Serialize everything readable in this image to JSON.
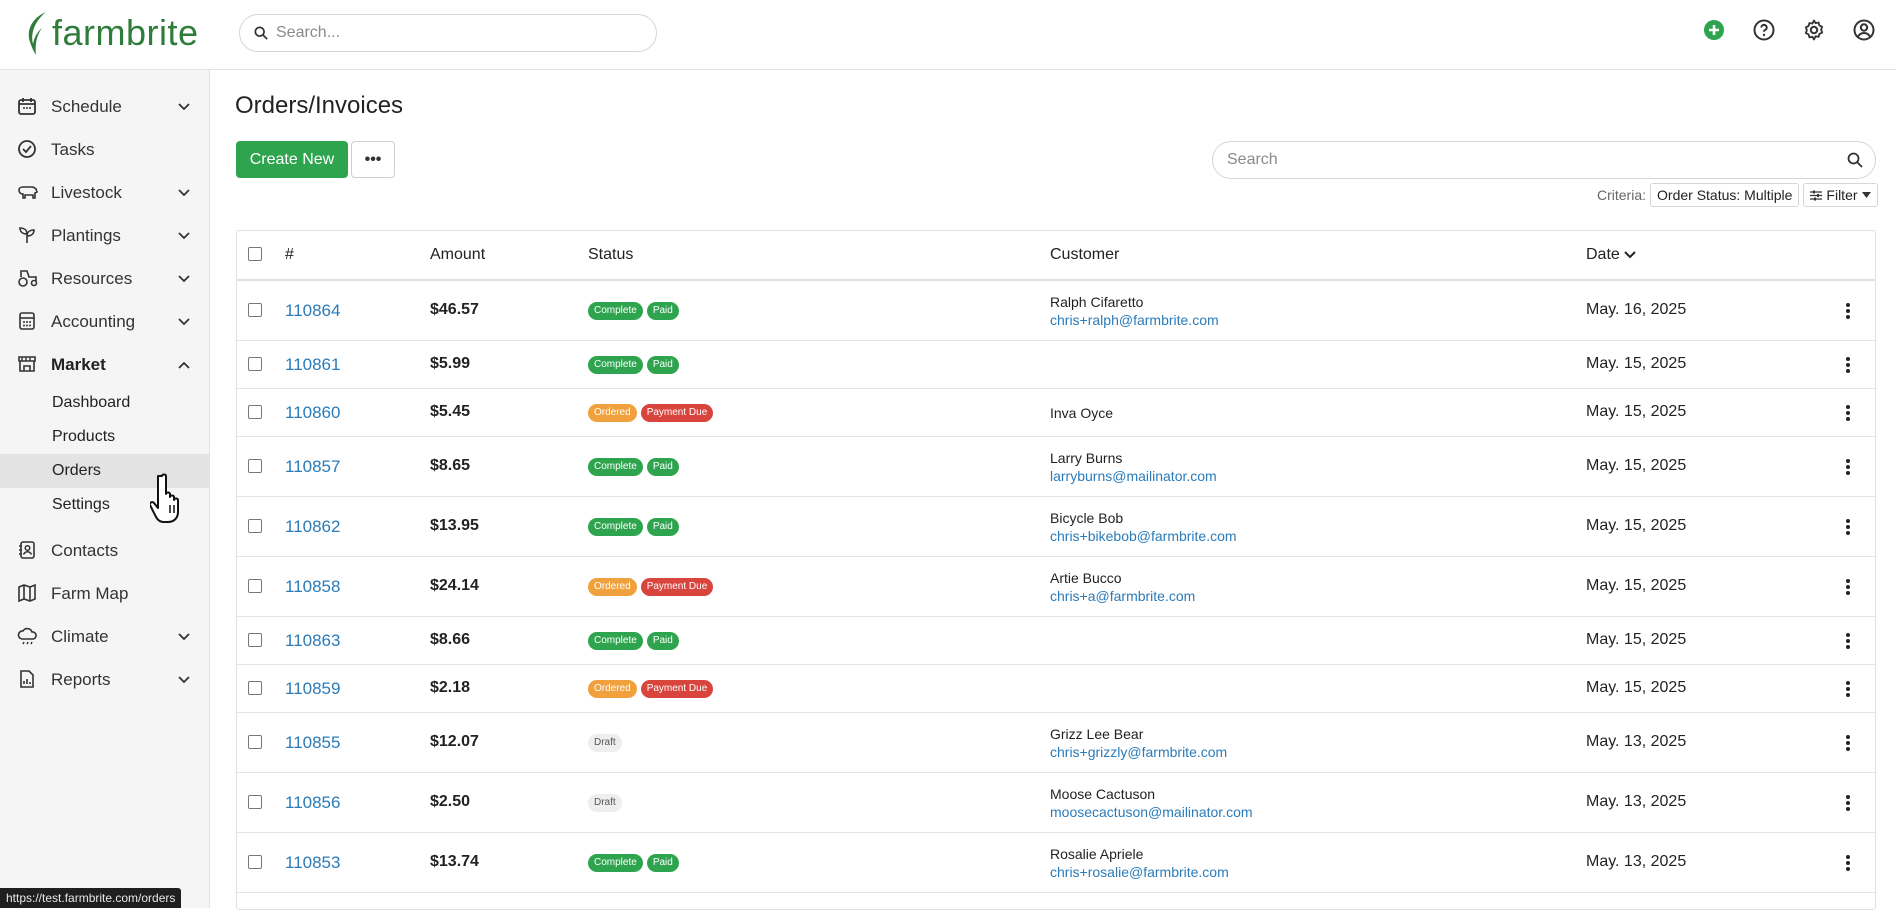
{
  "app": {
    "logo_text": "farmbrite",
    "brand_color": "#2f7d3a",
    "accent_green": "#2ea44f"
  },
  "topbar": {
    "search_placeholder": "Search...",
    "icons": [
      "add-circle-icon",
      "help-icon",
      "gear-icon",
      "user-icon"
    ]
  },
  "sidebar": {
    "items": [
      {
        "label": "Schedule",
        "icon": "calendar-icon",
        "chevron": "down"
      },
      {
        "label": "Tasks",
        "icon": "check-circle-icon",
        "chevron": ""
      },
      {
        "label": "Livestock",
        "icon": "livestock-icon",
        "chevron": "down"
      },
      {
        "label": "Plantings",
        "icon": "sprout-icon",
        "chevron": "down"
      },
      {
        "label": "Resources",
        "icon": "tractor-icon",
        "chevron": "down"
      },
      {
        "label": "Accounting",
        "icon": "calculator-icon",
        "chevron": "down"
      },
      {
        "label": "Market",
        "icon": "store-icon",
        "chevron": "up"
      },
      {
        "label": "Contacts",
        "icon": "contacts-icon",
        "chevron": ""
      },
      {
        "label": "Farm Map",
        "icon": "map-icon",
        "chevron": ""
      },
      {
        "label": "Climate",
        "icon": "cloud-icon",
        "chevron": "down"
      },
      {
        "label": "Reports",
        "icon": "report-icon",
        "chevron": "down"
      }
    ],
    "market_sub": [
      {
        "label": "Dashboard"
      },
      {
        "label": "Products"
      },
      {
        "label": "Orders",
        "active": true
      },
      {
        "label": "Settings"
      }
    ]
  },
  "main": {
    "title": "Orders/Invoices",
    "create_label": "Create New",
    "more_label": "•••",
    "search_placeholder": "Search",
    "criteria_label": "Criteria:",
    "criteria_chip": "Order Status: Multiple",
    "filter_label": "Filter"
  },
  "table": {
    "headers": {
      "id": "#",
      "amount": "Amount",
      "status": "Status",
      "customer": "Customer",
      "date": "Date"
    },
    "rows": [
      {
        "id": "110864",
        "amount": "$46.57",
        "badges": [
          "Complete",
          "Paid"
        ],
        "name": "Ralph Cifaretto",
        "email": "chris+ralph@farmbrite.com",
        "date": "May. 16, 2025"
      },
      {
        "id": "110861",
        "amount": "$5.99",
        "badges": [
          "Complete",
          "Paid"
        ],
        "name": "",
        "email": "",
        "date": "May. 15, 2025"
      },
      {
        "id": "110860",
        "amount": "$5.45",
        "badges": [
          "Ordered",
          "Payment Due"
        ],
        "name": "Inva Oyce",
        "email": "",
        "date": "May. 15, 2025"
      },
      {
        "id": "110857",
        "amount": "$8.65",
        "badges": [
          "Complete",
          "Paid"
        ],
        "name": "Larry Burns",
        "email": "larryburns@mailinator.com",
        "date": "May. 15, 2025"
      },
      {
        "id": "110862",
        "amount": "$13.95",
        "badges": [
          "Complete",
          "Paid"
        ],
        "name": "Bicycle Bob",
        "email": "chris+bikebob@farmbrite.com",
        "date": "May. 15, 2025"
      },
      {
        "id": "110858",
        "amount": "$24.14",
        "badges": [
          "Ordered",
          "Payment Due"
        ],
        "name": "Artie Bucco",
        "email": "chris+a@farmbrite.com",
        "date": "May. 15, 2025"
      },
      {
        "id": "110863",
        "amount": "$8.66",
        "badges": [
          "Complete",
          "Paid"
        ],
        "name": "",
        "email": "",
        "date": "May. 15, 2025"
      },
      {
        "id": "110859",
        "amount": "$2.18",
        "badges": [
          "Ordered",
          "Payment Due"
        ],
        "name": "",
        "email": "",
        "date": "May. 15, 2025"
      },
      {
        "id": "110855",
        "amount": "$12.07",
        "badges": [
          "Draft"
        ],
        "name": "Grizz Lee Bear",
        "email": "chris+grizzly@farmbrite.com",
        "date": "May. 13, 2025"
      },
      {
        "id": "110856",
        "amount": "$2.50",
        "badges": [
          "Draft"
        ],
        "name": "Moose Cactuson",
        "email": "moosecactuson@mailinator.com",
        "date": "May. 13, 2025"
      },
      {
        "id": "110853",
        "amount": "$13.74",
        "badges": [
          "Complete",
          "Paid"
        ],
        "name": "Rosalie Apriele",
        "email": "chris+rosalie@farmbrite.com",
        "date": "May. 13, 2025"
      }
    ]
  },
  "statusbar": {
    "url": "https://test.farmbrite.com/orders"
  }
}
